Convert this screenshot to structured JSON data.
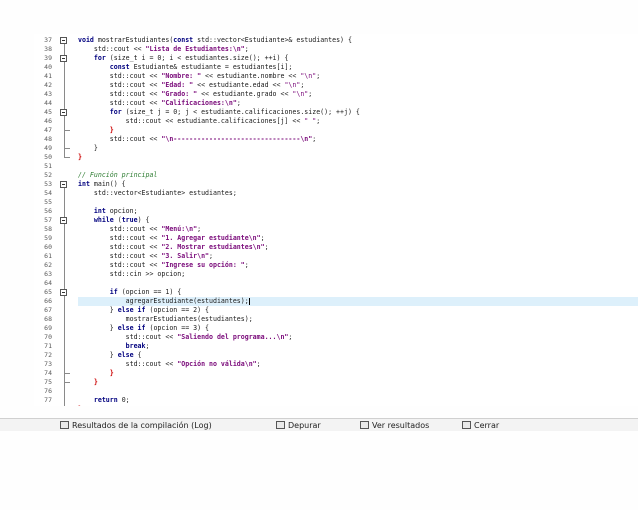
{
  "editor": {
    "lines": [
      {
        "n": "37",
        "html": "<span class='kw'>void</span> mostrarEstudiantes(<span class='kw'>const</span> std::vector&lt;Estudiante&gt;&amp; estudiantes) {"
      },
      {
        "n": "38",
        "html": "    std::cout &lt;&lt; <span class='str bold'>\"Lista de Estudiantes:\\n\"</span>;"
      },
      {
        "n": "39",
        "html": "    <span class='kw'>for</span> (size_t i = 0; i &lt; estudiantes.size(); ++i) {"
      },
      {
        "n": "40",
        "html": "        <span class='kw'>const</span> Estudiante&amp; estudiante = estudiantes[i];"
      },
      {
        "n": "41",
        "html": "        std::cout &lt;&lt; <span class='str bold'>\"Nombre: \"</span> &lt;&lt; estudiante.nombre &lt;&lt; <span class='str'>\"\\n\"</span>;"
      },
      {
        "n": "42",
        "html": "        std::cout &lt;&lt; <span class='str bold'>\"Edad: \"</span> &lt;&lt; estudiante.edad &lt;&lt; <span class='str'>\"\\n\"</span>;"
      },
      {
        "n": "43",
        "html": "        std::cout &lt;&lt; <span class='str bold'>\"Grado: \"</span> &lt;&lt; estudiante.grado &lt;&lt; <span class='str'>\"\\n\"</span>;"
      },
      {
        "n": "44",
        "html": "        std::cout &lt;&lt; <span class='str bold'>\"Calificaciones:\\n\"</span>;"
      },
      {
        "n": "45",
        "html": "        <span class='kw'>for</span> (size_t j = 0; j &lt; estudiante.calificaciones.size(); ++j) {"
      },
      {
        "n": "46",
        "html": "            std::cout &lt;&lt; estudiante.calificaciones[j] &lt;&lt; <span class='str'>\" \"</span>;"
      },
      {
        "n": "47",
        "html": "        <span class='brace-red'>}</span>"
      },
      {
        "n": "48",
        "html": "        std::cout &lt;&lt; <span class='str bold'>\"\\n--------------------------------\\n\"</span>;"
      },
      {
        "n": "49",
        "html": "    }"
      },
      {
        "n": "50",
        "html": "<span class='brace-red'>}</span>"
      },
      {
        "n": "51",
        "html": ""
      },
      {
        "n": "52",
        "html": "<span class='cm'>// Función principal</span>"
      },
      {
        "n": "53",
        "html": "<span class='kw'>int</span> main() {"
      },
      {
        "n": "54",
        "html": "    std::vector&lt;Estudiante&gt; estudiantes;"
      },
      {
        "n": "55",
        "html": ""
      },
      {
        "n": "56",
        "html": "    <span class='kw'>int</span> opcion;"
      },
      {
        "n": "57",
        "html": "    <span class='kw'>while</span> (<span class='kw'>true</span>) {"
      },
      {
        "n": "58",
        "html": "        std::cout &lt;&lt; <span class='str bold'>\"Menú:\\n\"</span>;"
      },
      {
        "n": "59",
        "html": "        std::cout &lt;&lt; <span class='str bold'>\"1. Agregar estudiante\\n\"</span>;"
      },
      {
        "n": "60",
        "html": "        std::cout &lt;&lt; <span class='str bold'>\"2. Mostrar estudiantes\\n\"</span>;"
      },
      {
        "n": "61",
        "html": "        std::cout &lt;&lt; <span class='str bold'>\"3. Salir\\n\"</span>;"
      },
      {
        "n": "62",
        "html": "        std::cout &lt;&lt; <span class='str bold'>\"Ingrese su opción: \"</span>;"
      },
      {
        "n": "63",
        "html": "        std::cin &gt;&gt; opcion;"
      },
      {
        "n": "64",
        "html": ""
      },
      {
        "n": "65",
        "html": "        <span class='kw'>if</span> (opcion == 1) {"
      },
      {
        "n": "66",
        "html": "            agregarEstudiante(estudiantes);<span class='caret'></span>",
        "hl": true
      },
      {
        "n": "67",
        "html": "        } <span class='kw'>else if</span> (opcion == 2) {"
      },
      {
        "n": "68",
        "html": "            mostrarEstudiantes(estudiantes);"
      },
      {
        "n": "69",
        "html": "        } <span class='kw'>else if</span> (opcion == 3) {"
      },
      {
        "n": "70",
        "html": "            std::cout &lt;&lt; <span class='str bold'>\"Saliendo del programa...\\n\"</span>;"
      },
      {
        "n": "71",
        "html": "            <span class='kw'>break</span>;"
      },
      {
        "n": "72",
        "html": "        } <span class='kw'>else</span> {"
      },
      {
        "n": "73",
        "html": "            std::cout &lt;&lt; <span class='str bold'>\"Opción no válida\\n\"</span>;"
      },
      {
        "n": "74",
        "html": "        <span class='brace-red'>}</span>"
      },
      {
        "n": "75",
        "html": "    <span class='brace-red'>}</span>"
      },
      {
        "n": "76",
        "html": ""
      },
      {
        "n": "77",
        "html": "    <span class='kw'>return</span> 0;"
      },
      {
        "n": "78",
        "html": "<span class='brace-red'>}</span>"
      },
      {
        "n": "79",
        "html": ""
      }
    ]
  },
  "tabs": [
    {
      "label": "Resultados de la compilación (Log)",
      "icon": "compile-log-icon"
    },
    {
      "label": "Depurar",
      "icon": "debug-icon"
    },
    {
      "label": "Ver resultados",
      "icon": "results-icon"
    },
    {
      "label": "Cerrar",
      "icon": "close-icon"
    }
  ]
}
